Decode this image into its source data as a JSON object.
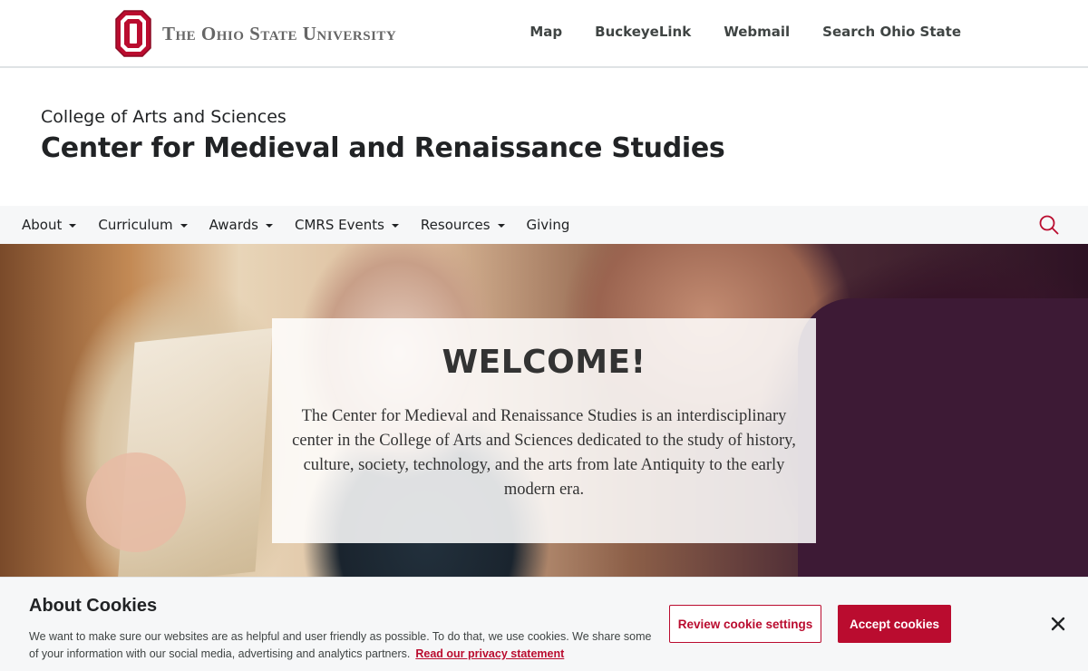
{
  "osu_header": {
    "wordmark": "The Ohio State University",
    "links": [
      "Map",
      "BuckeyeLink",
      "Webmail",
      "Search Ohio State"
    ]
  },
  "site": {
    "college": "College of Arts and Sciences",
    "title": "Center for Medieval and Renaissance Studies"
  },
  "nav": {
    "items": [
      {
        "label": "About",
        "has_dropdown": true
      },
      {
        "label": "Curriculum",
        "has_dropdown": true
      },
      {
        "label": "Awards",
        "has_dropdown": true
      },
      {
        "label": "CMRS Events",
        "has_dropdown": true
      },
      {
        "label": "Resources",
        "has_dropdown": true
      },
      {
        "label": "Giving",
        "has_dropdown": false
      }
    ],
    "search_icon": "search-icon"
  },
  "hero": {
    "title": "WELCOME!",
    "text": "The Center for Medieval and Renaissance Studies is an interdisciplinary center in the College of Arts and Sciences dedicated to the study of history, culture, society, technology, and the arts from late Antiquity to the early modern era."
  },
  "cookie_banner": {
    "title": "About Cookies",
    "text": "We want to make sure our websites are as helpful and user friendly as possible. To do that, we use cookies. We share some of your information with our social media, advertising and analytics partners.",
    "privacy_link": "Read our privacy statement",
    "review_button": "Review cookie settings",
    "accept_button": "Accept cookies",
    "close_icon": "close-icon"
  },
  "colors": {
    "scarlet": "#ba0c2f",
    "text_dark": "#212325",
    "nav_bg": "#f6f7f8"
  }
}
